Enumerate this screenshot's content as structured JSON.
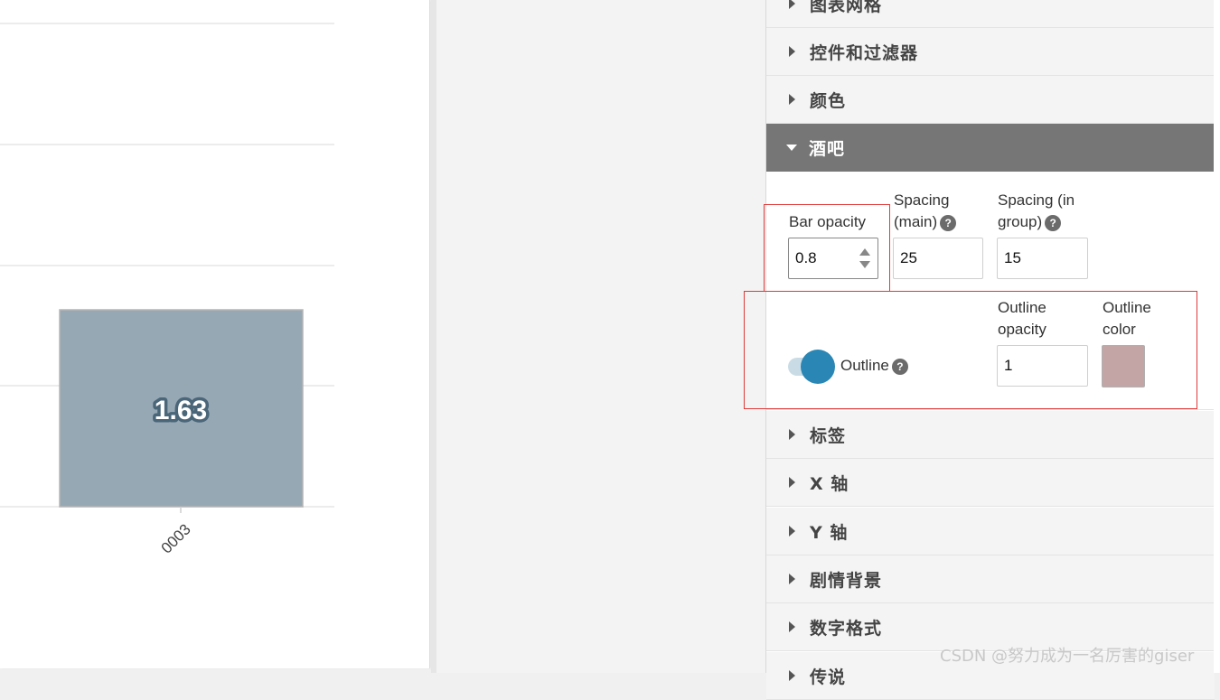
{
  "chart": {
    "bar_label": "1.63",
    "category_label": "0003",
    "bar_color": "#97a8b5",
    "label_outline_color": "#4a6678",
    "chart_data": {
      "type": "bar",
      "categories": [
        "0003"
      ],
      "values": [
        1.63
      ],
      "title": "",
      "xlabel": "",
      "ylabel": ""
    }
  },
  "sections": {
    "chart_grid": "图表网格",
    "controls_filters": "控件和过滤器",
    "colors": "颜色",
    "bars": "酒吧",
    "labels": "标签",
    "x_axis": "X 轴",
    "y_axis": "Y 轴",
    "storytelling": "剧情背景",
    "number_format": "数字格式",
    "legend": "传说"
  },
  "bars_panel": {
    "bar_opacity_label": "Bar opacity",
    "bar_opacity_value": "0.8",
    "spacing_main_label_1": "Spacing",
    "spacing_main_label_2": "(main)",
    "spacing_main_value": "25",
    "spacing_group_label_1": "Spacing (in",
    "spacing_group_label_2": "group)",
    "spacing_group_value": "15",
    "outline_label": "Outline",
    "outline_opacity_label_1": "Outline",
    "outline_opacity_label_2": "opacity",
    "outline_opacity_value": "1",
    "outline_color_label_1": "Outline",
    "outline_color_label_2": "color",
    "help_glyph": "?",
    "outline_color_value": "#c3a5a5",
    "toggle_color": "#2a86b4"
  },
  "watermark": "CSDN @努力成为一名厉害的giser"
}
